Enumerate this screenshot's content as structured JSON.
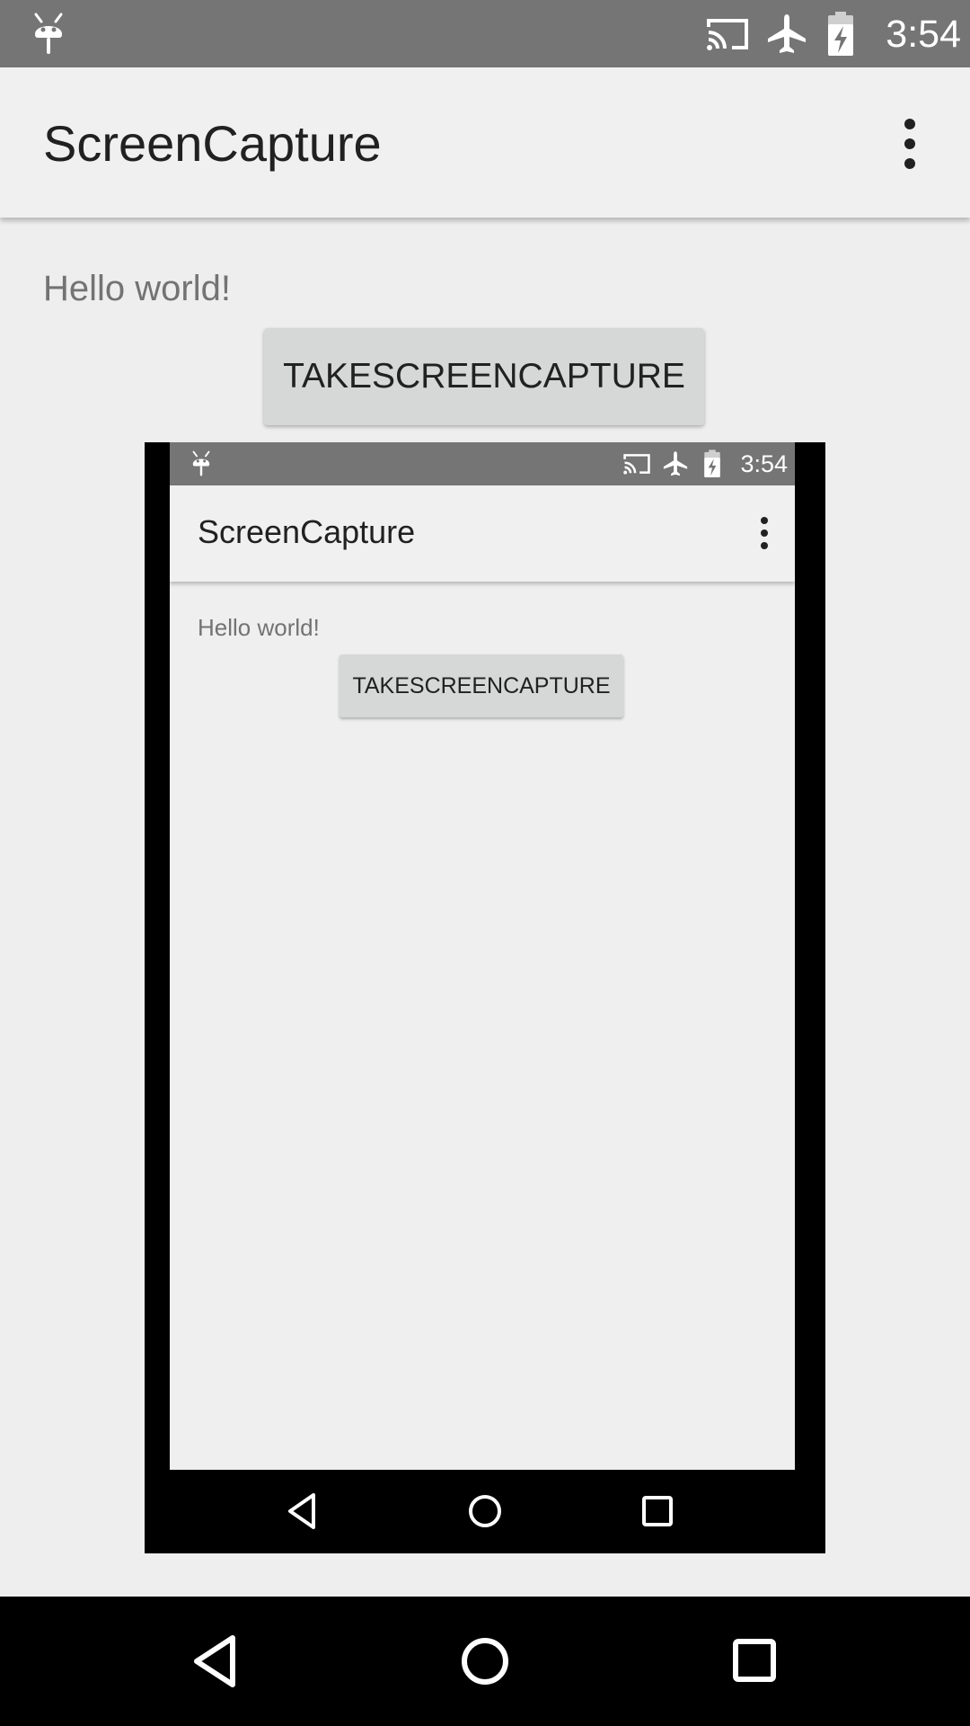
{
  "status_bar": {
    "time": "3:54",
    "icons": [
      "android-icon",
      "cast-icon",
      "airplane-icon",
      "battery-charging-icon"
    ]
  },
  "app_bar": {
    "title": "ScreenCapture",
    "overflow_icon": "more-vert-icon"
  },
  "content": {
    "hello_text": "Hello world!",
    "capture_button_label": "TAKESCREENCAPTURE"
  },
  "captured_screenshot": {
    "status_time": "3:54",
    "title": "ScreenCapture",
    "hello_text": "Hello world!",
    "button_label": "TAKESCREENCAPTURE",
    "nav_icons": [
      "back-icon",
      "home-icon",
      "recents-icon"
    ]
  },
  "nav_bar": {
    "icons": [
      "back-icon",
      "home-icon",
      "recents-icon"
    ]
  }
}
